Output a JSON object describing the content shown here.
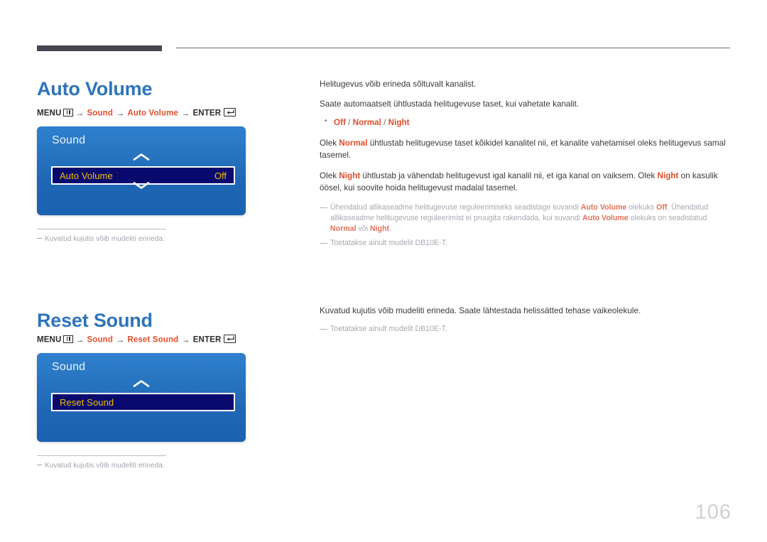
{
  "page": {
    "number": "106"
  },
  "sections": [
    {
      "id": "auto-volume",
      "title": "Auto Volume",
      "menu_path": {
        "menu_label": "MENU",
        "menu_icon": "menu-grid-icon",
        "arrow": "→",
        "step1": "Sound",
        "step2": "Auto Volume",
        "enter_label": "ENTER",
        "enter_icon": "enter-key-icon"
      },
      "osd": {
        "title": "Sound",
        "chevron_up": "chevron-up-icon",
        "chevron_down": "chevron-down-icon",
        "row_label": "Auto Volume",
        "row_value": "Off"
      },
      "panel_note": "Kuvatud kujutis võib mudeliti erineda.",
      "body": {
        "p1": "Helitugevus võib erineda sõltuvalt kanalist.",
        "p2": "Saate automaatselt ühtlustada helitugevuse taset, kui vahetate kanalit.",
        "bullet": {
          "opt1": "Off",
          "sep1": " / ",
          "opt2": "Normal",
          "sep2": " / ",
          "opt3": "Night"
        },
        "p3_a": "Olek ",
        "p3_b": "Normal",
        "p3_c": " ühtlustab helitugevuse taset kõikidel kanalitel nii, et kanalite vahetamisel oleks helitugevus samal tasemel.",
        "p4_a": "Olek ",
        "p4_b": "Night",
        "p4_c": " ühtlustab ja vähendab helitugevust igal kanalil nii, et iga kanal on vaiksem. Olek ",
        "p4_d": "Night",
        "p4_e": " on kasulik öösel, kui soovite hoida helitugevust madalal tasemel.",
        "note1_a": "Ühendatud allikaseadme helitugevuse reguleerimiseks seadistage suvandi ",
        "note1_b": "Auto Volume",
        "note1_c": " olekuks ",
        "note1_d": "Off",
        "note1_e": ". Ühendatud allikaseadme helitugevuse reguleerimist ei pruugita rakendada, kui suvandi ",
        "note1_f": "Auto Volume",
        "note1_g": " olekuks on seadistatud ",
        "note1_h": "Normal",
        "note1_i": " või ",
        "note1_j": "Night",
        "note1_k": ".",
        "note2": "Toetatakse ainult mudelit DB10E-T."
      }
    },
    {
      "id": "reset-sound",
      "title": "Reset Sound",
      "menu_path": {
        "menu_label": "MENU",
        "menu_icon": "menu-grid-icon",
        "arrow": "→",
        "step1": "Sound",
        "step2": "Reset Sound",
        "enter_label": "ENTER",
        "enter_icon": "enter-key-icon"
      },
      "osd": {
        "title": "Sound",
        "chevron_up": "chevron-up-icon",
        "row_label": "Reset Sound",
        "row_value": ""
      },
      "panel_note": "Kuvatud kujutis võib mudeliti erineda.",
      "body": {
        "p1": "Kuvatud kujutis võib mudeliti erineda. Saate lähtestada helissätted tehase vaikeolekule.",
        "note1": "Toetatakse ainult mudelit DB10E-T."
      }
    }
  ],
  "colors": {
    "heading": "#2d74bb",
    "accent_orange": "#e04e2b",
    "osd_blue": "#2a7ac6",
    "osd_row_bg": "#0a0a6e",
    "osd_row_text": "#f0c000",
    "note_gray": "#a8a8b2"
  }
}
